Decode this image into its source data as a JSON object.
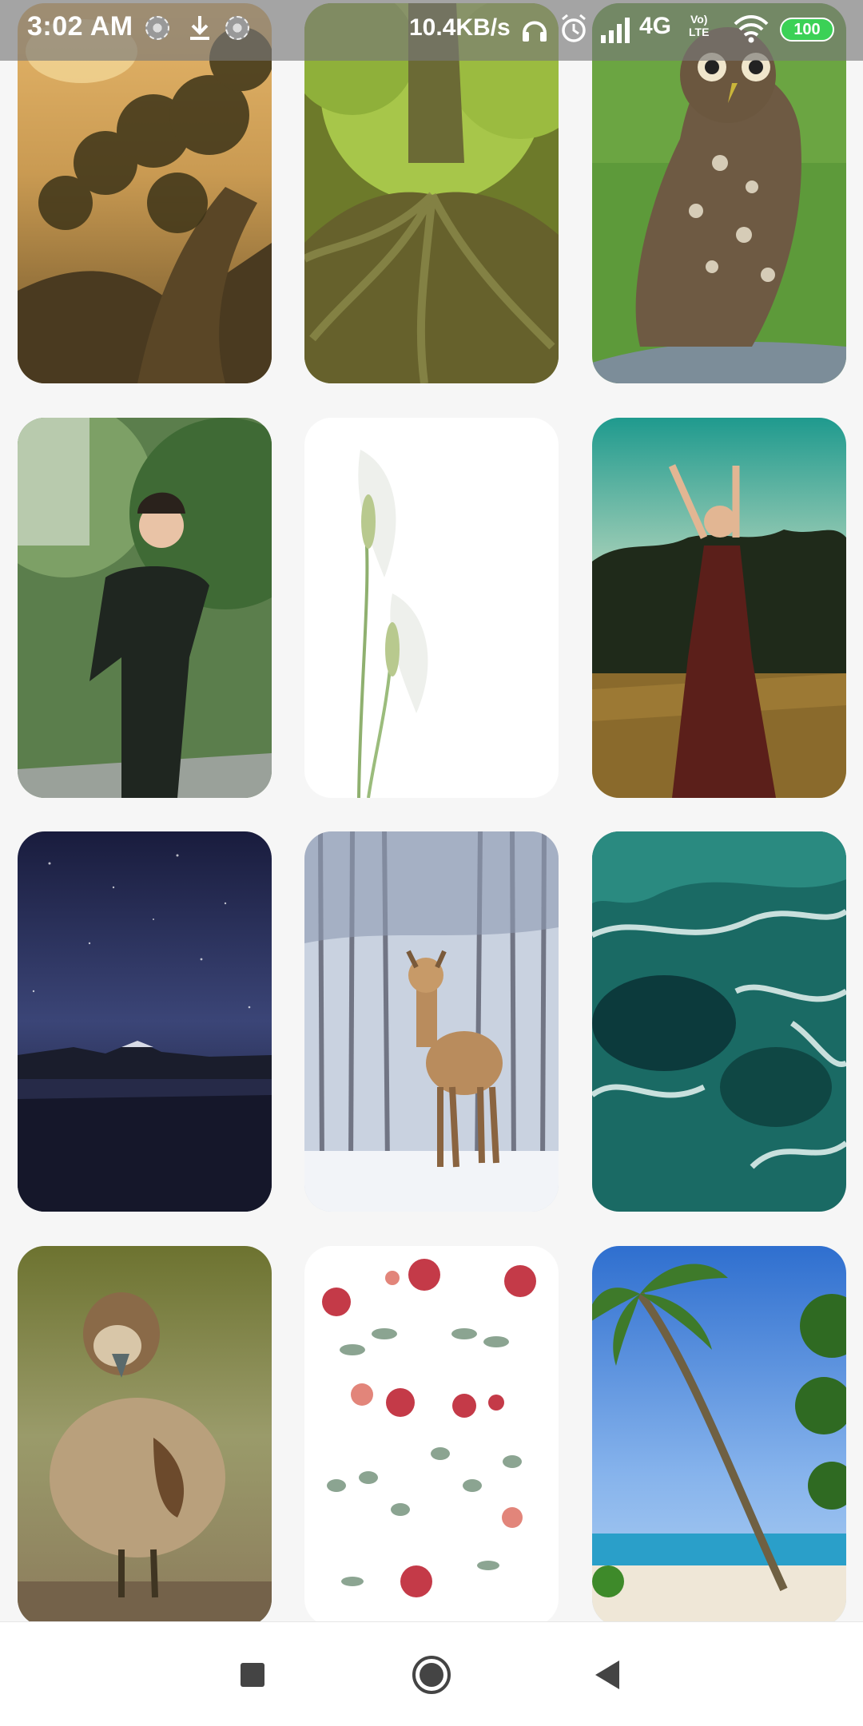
{
  "status_bar": {
    "time": "3:02 AM",
    "network_speed": "10.4KB/s",
    "network_type": "4G",
    "volte_line1": "Vo)",
    "volte_line2": "LTE",
    "battery": "100",
    "icons": [
      "sync-icon",
      "download-icon",
      "sync-icon",
      "headphones-icon",
      "alarm-icon",
      "signal-icon",
      "wifi-icon",
      "battery-icon"
    ]
  },
  "wallpapers": [
    {
      "subject": "tree-canopy-sunlight"
    },
    {
      "subject": "tree-roots-forest"
    },
    {
      "subject": "owl"
    },
    {
      "subject": "woman-black-dress"
    },
    {
      "subject": "white-calla-flower"
    },
    {
      "subject": "woman-arms-raised-field"
    },
    {
      "subject": "night-sky-lake"
    },
    {
      "subject": "deer-snow-forest"
    },
    {
      "subject": "ocean-waves"
    },
    {
      "subject": "gosling"
    },
    {
      "subject": "watercolor-flowers"
    },
    {
      "subject": "palm-beach"
    }
  ],
  "nav_bar": {
    "icons": [
      "recent-apps-icon",
      "home-icon",
      "back-icon"
    ]
  },
  "colors": {
    "status_bar_bg": "#787878",
    "battery": "#3bd156",
    "nav_icon": "#444444",
    "page_bg": "#f6f6f6"
  }
}
